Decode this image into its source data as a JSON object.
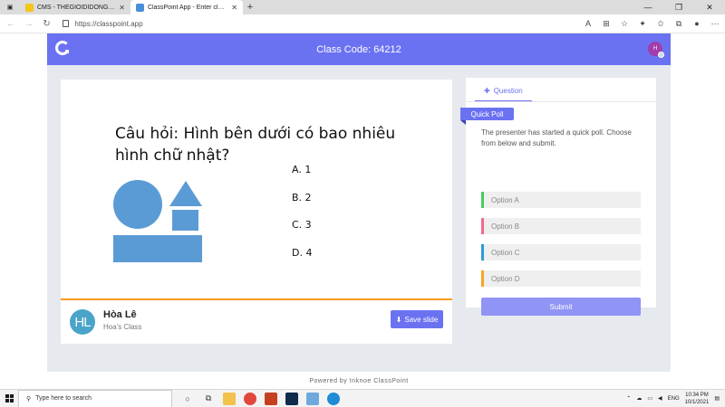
{
  "browser": {
    "tabs": [
      {
        "title": "CMS - THEGIOIDIDONG.COM",
        "favicon_color": "#f5c518"
      },
      {
        "title": "ClassPoint App - Enter class code",
        "favicon_color": "#4a90d9"
      }
    ],
    "new_tab": "+",
    "url": "https://classpoint.app"
  },
  "header": {
    "class_code": "Class Code: 64212",
    "avatar_initial": "H"
  },
  "slide": {
    "question": "Câu hỏi: Hình bên dưới có bao nhiêu hình chữ nhật?",
    "answers": [
      "A. 1",
      "B. 2",
      "C. 3",
      "D. 4"
    ],
    "shape_color": "#5b9bd5"
  },
  "presenter": {
    "initials": "HL",
    "name": "Hòa Lê",
    "class_name": "Hoa's Class",
    "save_button": "Save slide"
  },
  "panel": {
    "tab_label": "Question",
    "badge": "Quick Poll",
    "instructions": "The presenter has started a quick poll. Choose from below and submit.",
    "options": [
      {
        "label": "Option A",
        "color": "#4ccb5b"
      },
      {
        "label": "Option B",
        "color": "#f06b8e"
      },
      {
        "label": "Option C",
        "color": "#2b9bd6"
      },
      {
        "label": "Option D",
        "color": "#f5a623"
      }
    ],
    "submit_label": "Submit"
  },
  "footer": {
    "powered_by": "Powered by Inknoe ClassPoint"
  },
  "taskbar": {
    "search_placeholder": "Type here to search",
    "language": "ENG",
    "time": "10:34 PM",
    "date": "10/1/2021"
  },
  "colors": {
    "accent": "#6b72f2",
    "slide_border": "#f59e0b"
  }
}
